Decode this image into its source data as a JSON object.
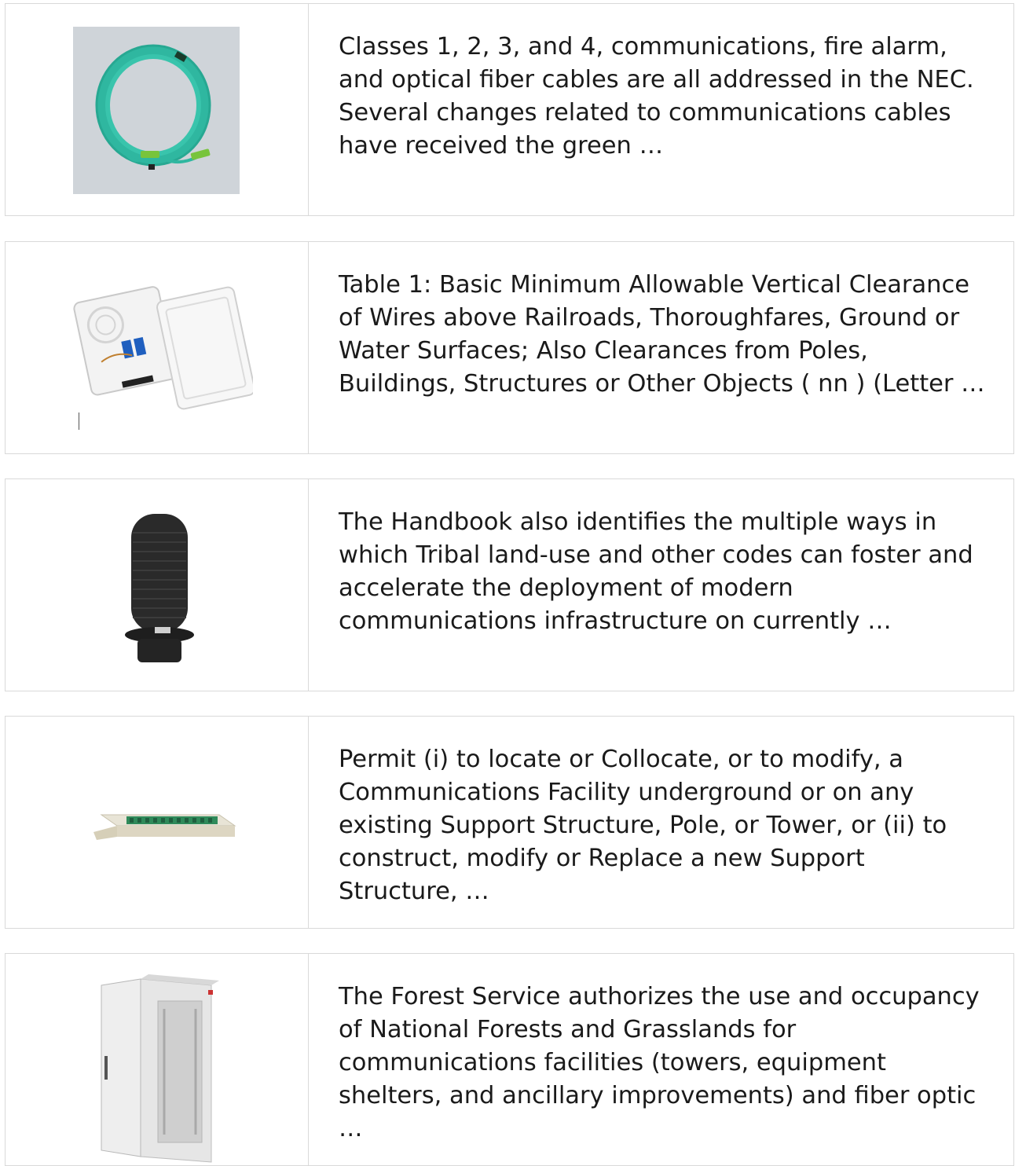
{
  "products": [
    {
      "icon": "fiber-cable-coil-image",
      "description": "Classes 1, 2, 3, and 4, communications, fire alarm, and optical fiber cables are all addressed in the NEC. Several changes related to communications cables have received the green …"
    },
    {
      "icon": "fiber-terminal-box-image",
      "description": "Table 1: Basic Minimum Allowable Vertical Clearance of Wires above Railroads, Thoroughfares, Ground or Water Surfaces; Also Clearances from Poles, Buildings, Structures or Other Objects ( nn ) (Letter …"
    },
    {
      "icon": "splice-closure-image",
      "description": "The Handbook also identifies the multiple ways in which Tribal land-use and other codes can foster and accelerate the deployment of modern communications infrastructure on currently …"
    },
    {
      "icon": "patch-panel-image",
      "description": "Permit (i) to locate or Collocate, or to modify, a Communications Facility underground or on any existing Support Structure, Pole, or Tower, or (ii) to construct, modify or Replace a new Support Structure, …"
    },
    {
      "icon": "outdoor-cabinet-image",
      "description": "The Forest Service authorizes the use and occupancy of National Forests and Grasslands for communications facilities (towers, equipment shelters, and ancillary improvements) and fiber optic …"
    }
  ]
}
